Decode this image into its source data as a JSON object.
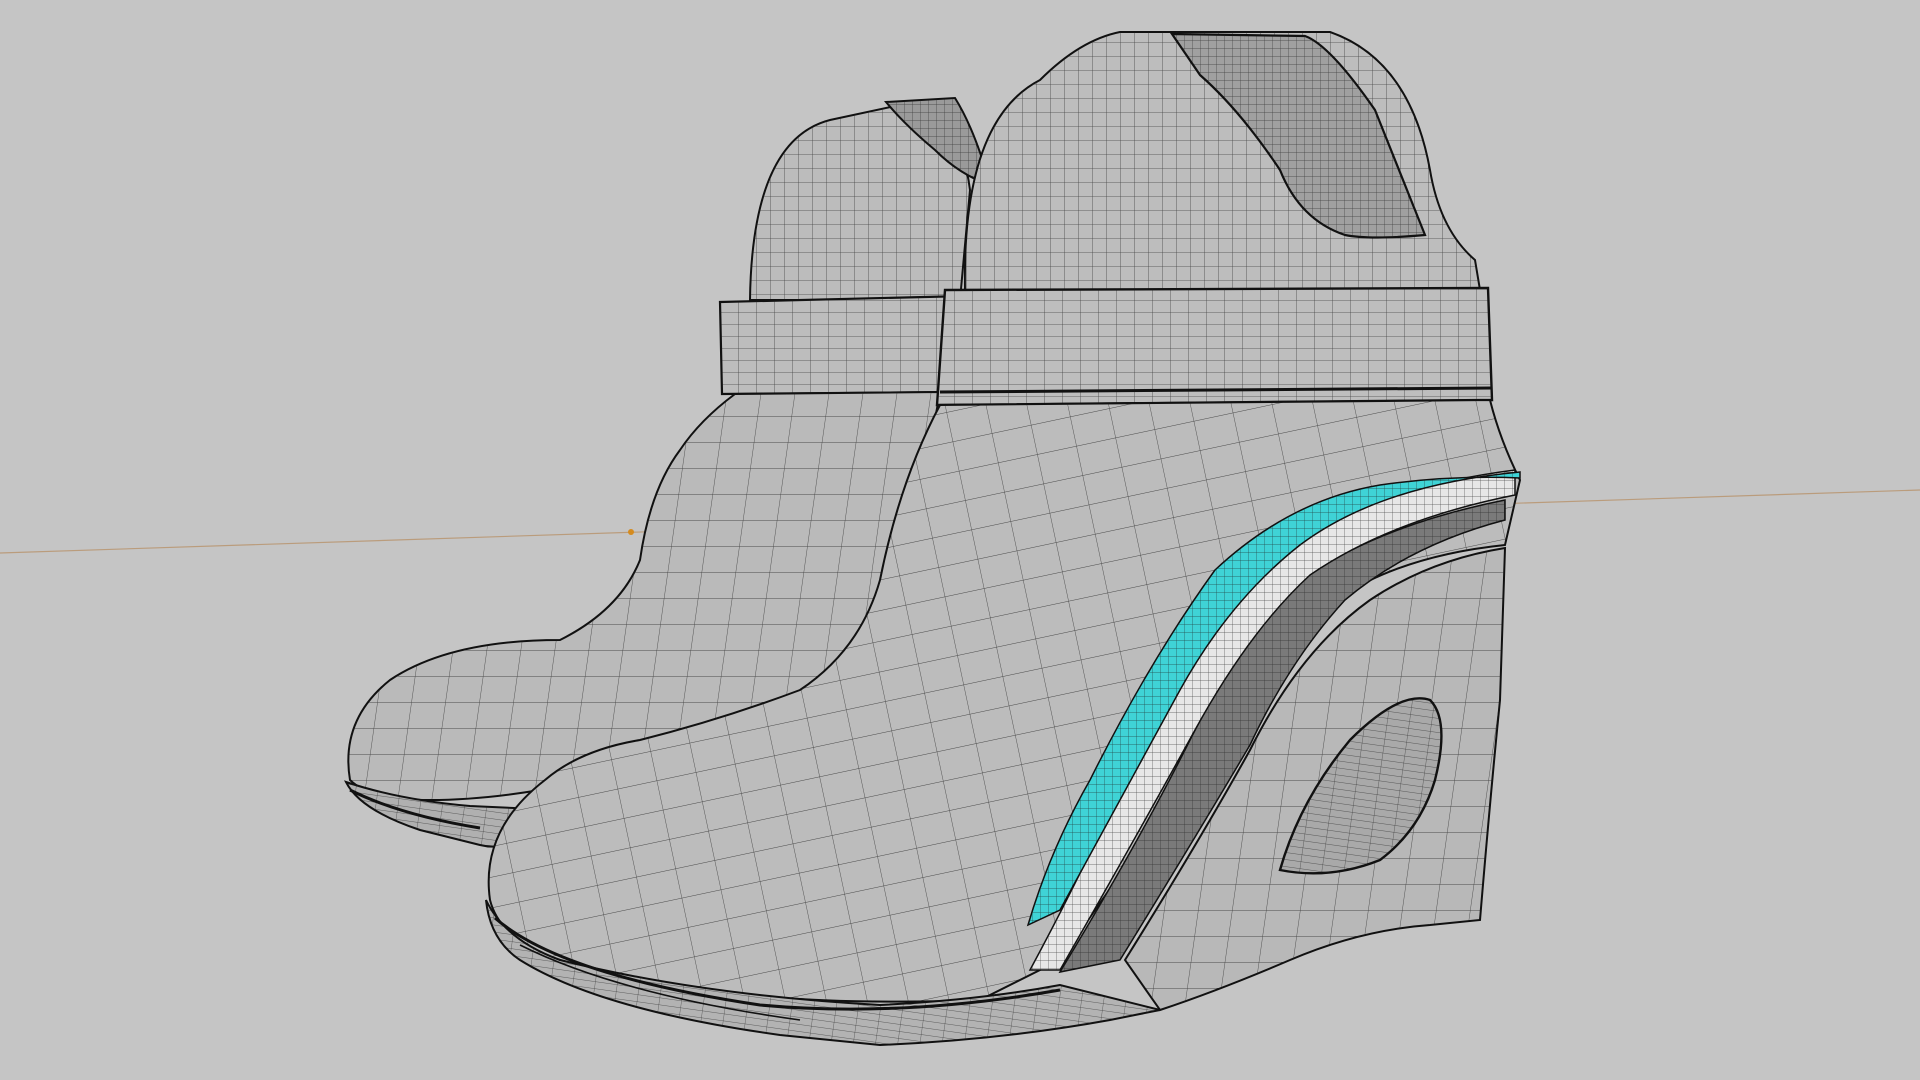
{
  "viewport": {
    "background": "#c5c5c5",
    "mesh_color": "#b9b9b9",
    "wire_color": "#1a1a1a",
    "accent_stripe_color": "#3fd3d6",
    "accent_stripe_light": "#e7e7e7",
    "accent_stripe_dark": "#7a7a7a",
    "horizon_color": "#b8926a",
    "origin_dot_color": "#d58b1e"
  },
  "scene": {
    "object": "high-heel-wedge-boots-pair",
    "render_mode": "wireframe-on-shaded"
  }
}
